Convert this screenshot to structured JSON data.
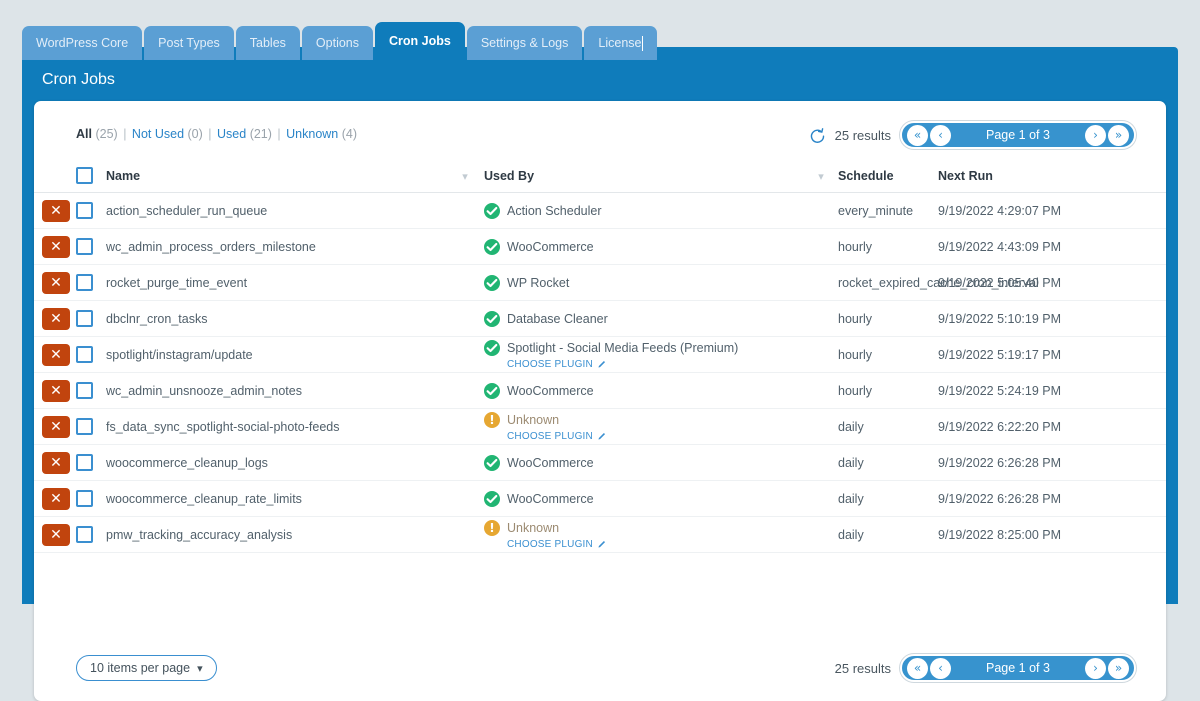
{
  "theme": {
    "brand_blue": "#0f7cbb",
    "tab_inactive": "#5b9fd4",
    "pager_blue": "#3793ce",
    "delete_red": "#c1440e",
    "ok_green": "#21b573",
    "warn_amber": "#e6a732",
    "link_blue": "#2a84c8",
    "page_bg": "#dde4e8"
  },
  "tabs": [
    {
      "label": "WordPress Core",
      "active": false
    },
    {
      "label": "Post Types",
      "active": false
    },
    {
      "label": "Tables",
      "active": false
    },
    {
      "label": "Options",
      "active": false
    },
    {
      "label": "Cron Jobs",
      "active": true
    },
    {
      "label": "Settings & Logs",
      "active": false
    },
    {
      "label": "License",
      "active": false
    }
  ],
  "panel": {
    "title": "Cron Jobs"
  },
  "filters": {
    "all": {
      "label": "All",
      "count": "(25)"
    },
    "not_used": {
      "label": "Not Used",
      "count": "(0)"
    },
    "used": {
      "label": "Used",
      "count": "(21)"
    },
    "unknown": {
      "label": "Unknown",
      "count": "(4)"
    }
  },
  "toolbar": {
    "refresh_icon": "refresh-icon",
    "results": "25 results"
  },
  "pager": {
    "first_label": "«",
    "prev_label": "‹",
    "page_label": "Page 1 of 3",
    "next_label": "›",
    "last_label": "»"
  },
  "table": {
    "headers": {
      "name": "Name",
      "used_by": "Used By",
      "schedule": "Schedule",
      "next_run": "Next Run"
    },
    "delete_glyph": "✕",
    "rows": [
      {
        "name": "action_scheduler_run_queue",
        "used_by": "Action Scheduler",
        "status": "ok",
        "choose_plugin": null,
        "schedule": "every_minute",
        "next_run": "9/19/2022 4:29:07 PM"
      },
      {
        "name": "wc_admin_process_orders_milestone",
        "used_by": "WooCommerce",
        "status": "ok",
        "choose_plugin": null,
        "schedule": "hourly",
        "next_run": "9/19/2022 4:43:09 PM"
      },
      {
        "name": "rocket_purge_time_event",
        "used_by": "WP Rocket",
        "status": "ok",
        "choose_plugin": null,
        "schedule": "rocket_expired_cache_cron_interval",
        "next_run": "9/19/2022 5:05:40 PM"
      },
      {
        "name": "dbclnr_cron_tasks",
        "used_by": "Database Cleaner",
        "status": "ok",
        "choose_plugin": null,
        "schedule": "hourly",
        "next_run": "9/19/2022 5:10:19 PM"
      },
      {
        "name": "spotlight/instagram/update",
        "used_by": "Spotlight - Social Media Feeds (Premium)",
        "status": "ok",
        "choose_plugin": "CHOOSE PLUGIN",
        "schedule": "hourly",
        "next_run": "9/19/2022 5:19:17 PM"
      },
      {
        "name": "wc_admin_unsnooze_admin_notes",
        "used_by": "WooCommerce",
        "status": "ok",
        "choose_plugin": null,
        "schedule": "hourly",
        "next_run": "9/19/2022 5:24:19 PM"
      },
      {
        "name": "fs_data_sync_spotlight-social-photo-feeds",
        "used_by": "Unknown",
        "status": "warn",
        "choose_plugin": "CHOOSE PLUGIN",
        "schedule": "daily",
        "next_run": "9/19/2022 6:22:20 PM"
      },
      {
        "name": "woocommerce_cleanup_logs",
        "used_by": "WooCommerce",
        "status": "ok",
        "choose_plugin": null,
        "schedule": "daily",
        "next_run": "9/19/2022 6:26:28 PM"
      },
      {
        "name": "woocommerce_cleanup_rate_limits",
        "used_by": "WooCommerce",
        "status": "ok",
        "choose_plugin": null,
        "schedule": "daily",
        "next_run": "9/19/2022 6:26:28 PM"
      },
      {
        "name": "pmw_tracking_accuracy_analysis",
        "used_by": "Unknown",
        "status": "warn",
        "choose_plugin": "CHOOSE PLUGIN",
        "schedule": "daily",
        "next_run": "9/19/2022 8:25:00 PM"
      }
    ]
  },
  "footer": {
    "per_page": "10 items per page",
    "results": "25 results"
  }
}
